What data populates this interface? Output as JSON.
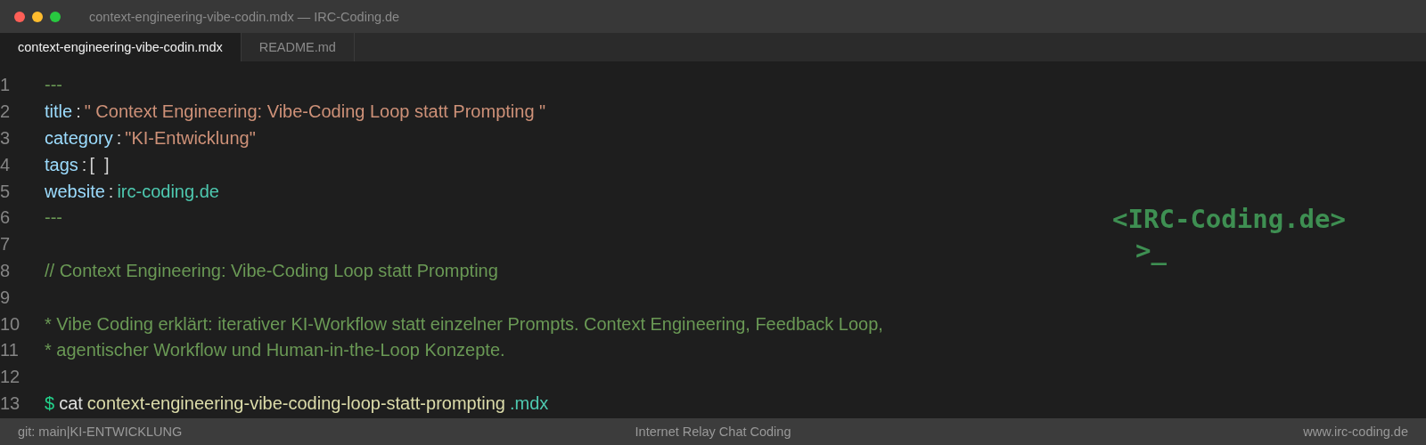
{
  "window": {
    "title": "context-engineering-vibe-codin.mdx — IRC-Coding.de"
  },
  "tabs": [
    {
      "label": "context-engineering-vibe-codin.mdx",
      "selected": true
    },
    {
      "label": "README.md",
      "selected": false
    }
  ],
  "editor": {
    "lines": [
      {
        "number": "1",
        "tokens": [
          {
            "kind": "dashes",
            "text": "---"
          }
        ]
      },
      {
        "number": "2",
        "tokens": [
          {
            "kind": "key",
            "text": "title"
          },
          {
            "kind": "punct",
            "text": ":"
          },
          {
            "kind": "string",
            "text": "\" Context Engineering: Vibe-Coding Loop statt Prompting \""
          }
        ]
      },
      {
        "number": "3",
        "tokens": [
          {
            "kind": "key",
            "text": "category"
          },
          {
            "kind": "punct",
            "text": ":"
          },
          {
            "kind": "string",
            "text": "\"KI-Entwicklung\""
          }
        ]
      },
      {
        "number": "4",
        "tokens": [
          {
            "kind": "key",
            "text": "tags"
          },
          {
            "kind": "punct",
            "text": ":"
          },
          {
            "kind": "punct",
            "text": "[  ]"
          }
        ]
      },
      {
        "number": "5",
        "tokens": [
          {
            "kind": "key",
            "text": "website"
          },
          {
            "kind": "punct",
            "text": ":"
          },
          {
            "kind": "link",
            "text": "irc-coding.de"
          }
        ]
      },
      {
        "number": "6",
        "tokens": [
          {
            "kind": "dashes",
            "text": "---"
          }
        ]
      },
      {
        "number": "7"
      },
      {
        "number": "8",
        "tokens": [
          {
            "kind": "comment",
            "text": "// Context Engineering: Vibe-Coding Loop statt Prompting"
          }
        ]
      },
      {
        "number": "9"
      },
      {
        "number": "10",
        "tokens": [
          {
            "kind": "comment",
            "text": "* Vibe Coding erklärt: iterativer KI-Workflow statt einzelner Prompts. Context Engineering, Feedback Loop,"
          }
        ]
      },
      {
        "number": "11",
        "tokens": [
          {
            "kind": "comment",
            "text": "* agentischer Workflow und Human-in-the-Loop Konzepte."
          }
        ]
      },
      {
        "number": "12"
      },
      {
        "number": "13",
        "tokens": [
          {
            "kind": "prompt",
            "text": "$"
          },
          {
            "kind": "command",
            "text": "cat"
          },
          {
            "kind": "filename",
            "text": "context-engineering-vibe-coding-loop-statt-prompting"
          },
          {
            "kind": "link",
            "text": ".mdx"
          }
        ]
      }
    ]
  },
  "logo": {
    "name": "<IRC-Coding.de>",
    "cursor": ">_"
  },
  "status_bar": {
    "left": "git: main|KI-ENTWICKLUNG",
    "center": "Internet Relay Chat Coding",
    "right": "www.irc-coding.de"
  }
}
